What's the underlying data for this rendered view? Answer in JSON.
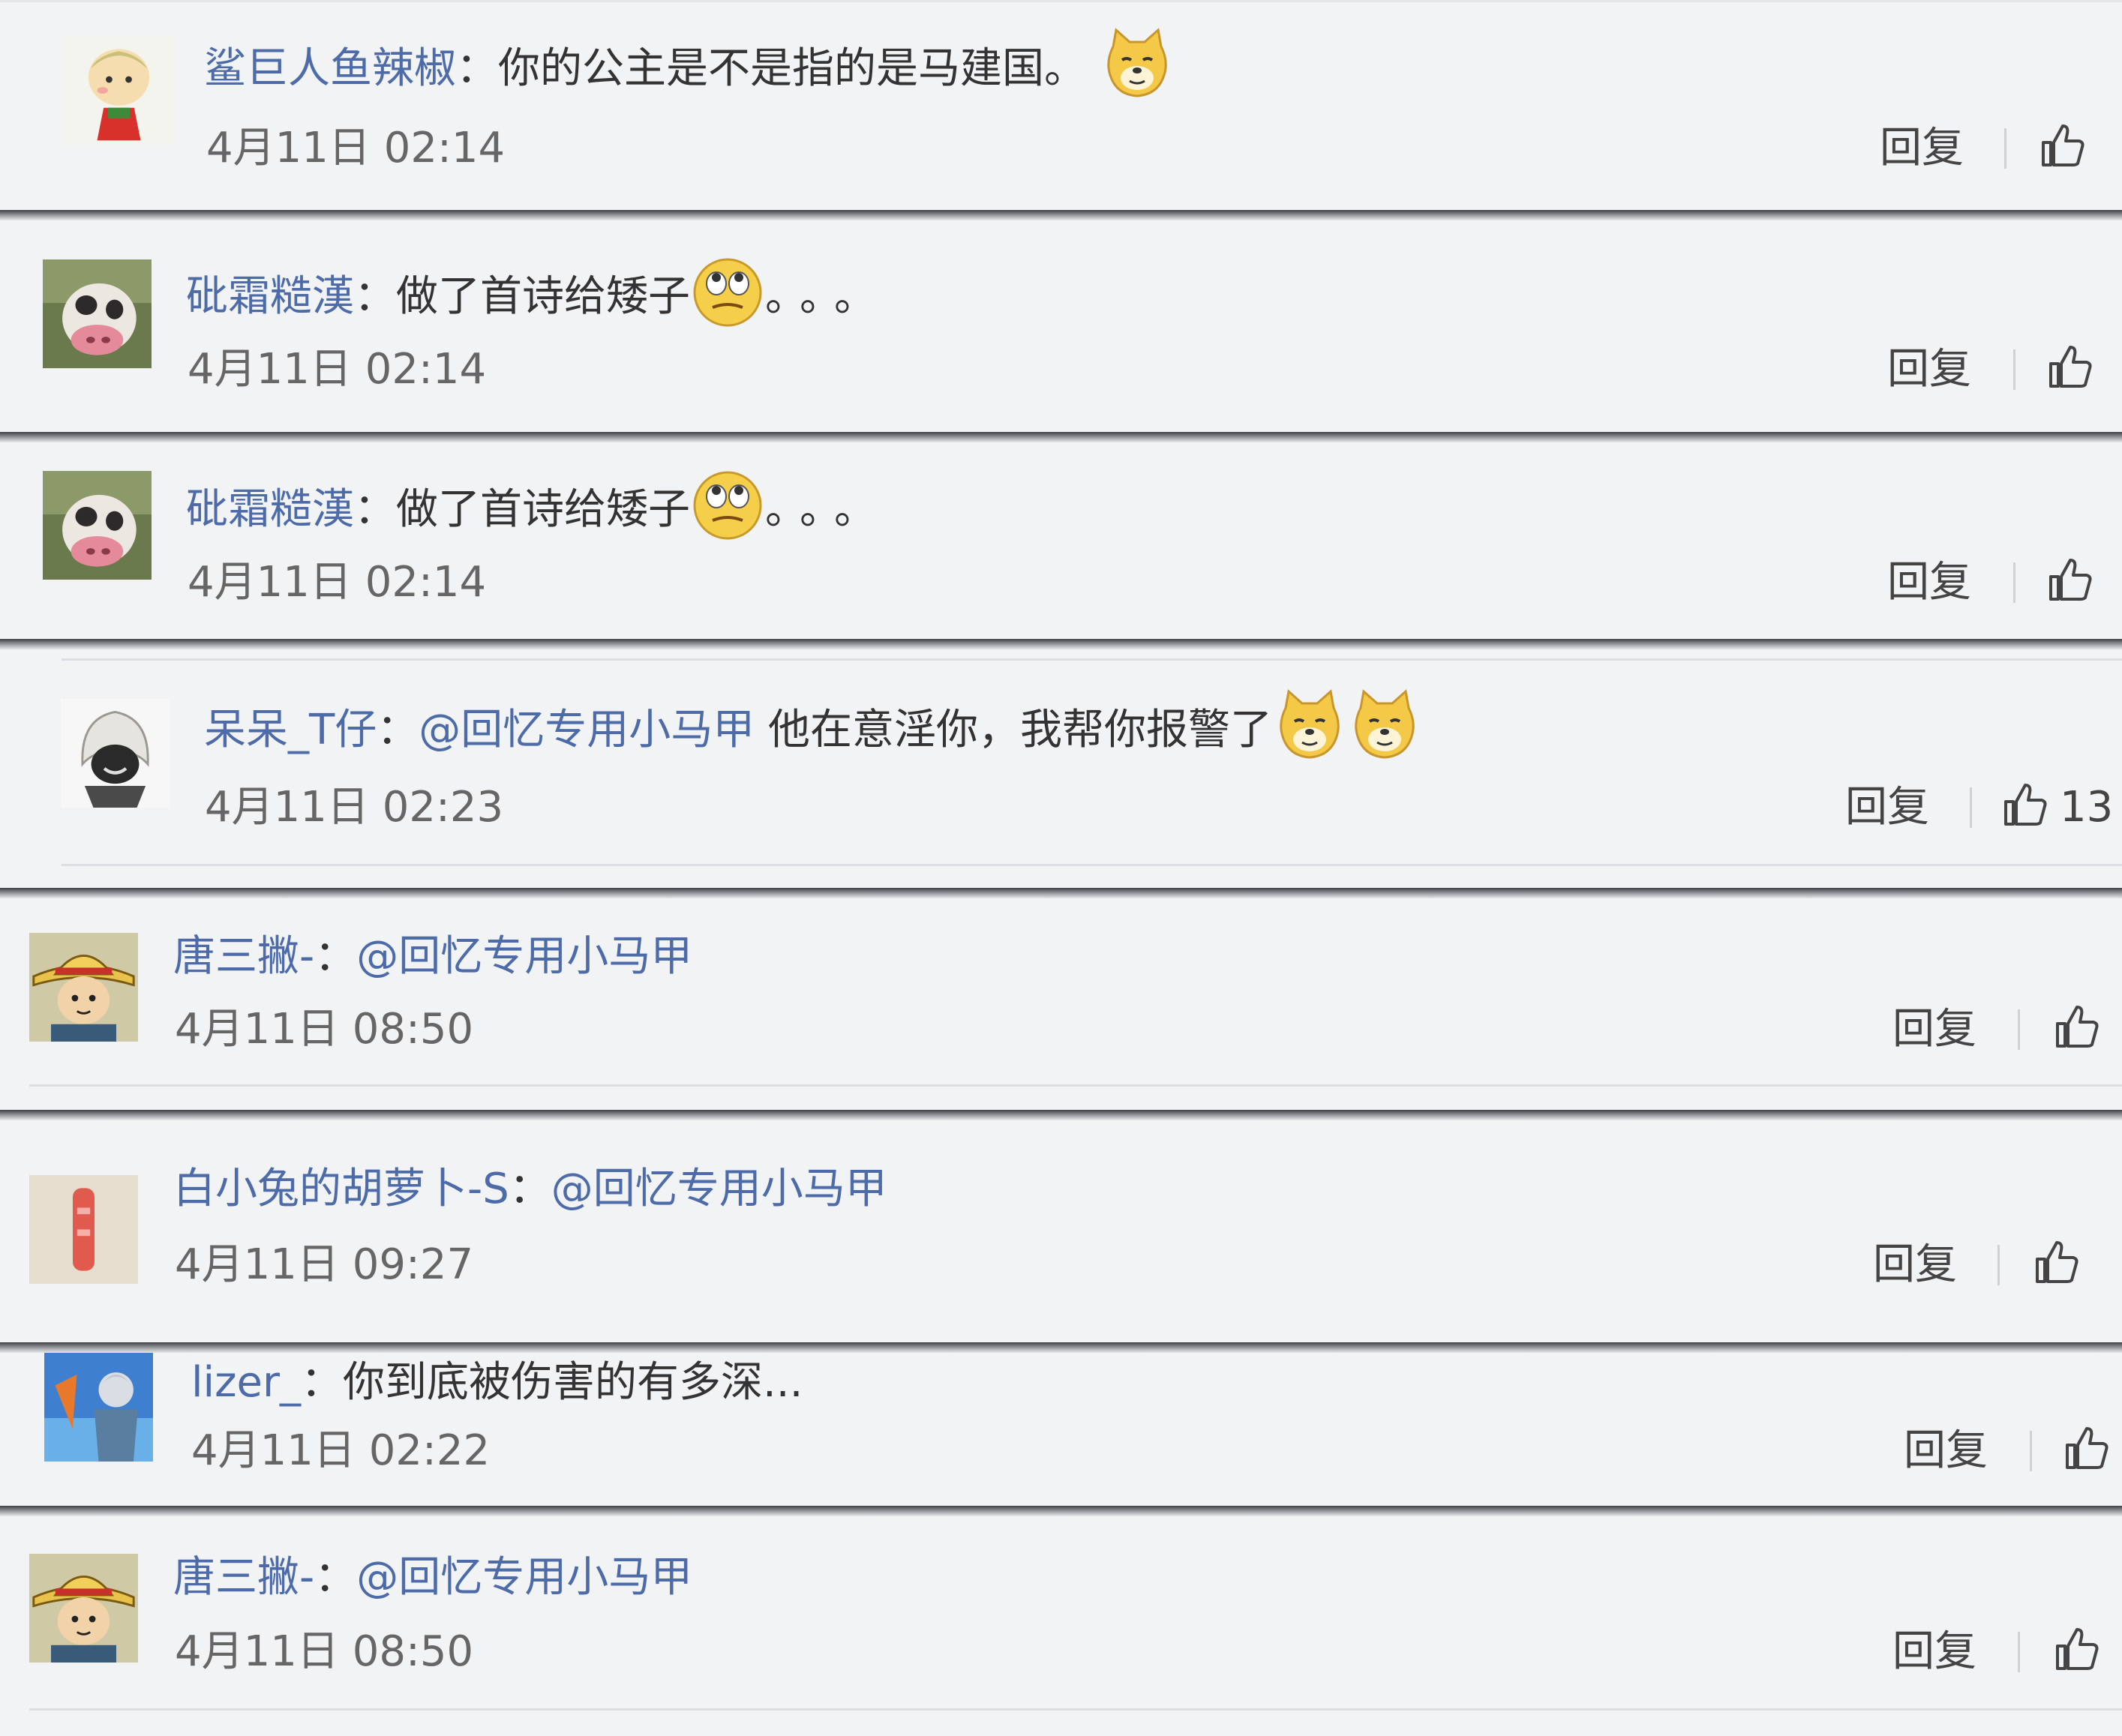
{
  "actions": {
    "reply_label": "回复"
  },
  "comments": [
    {
      "user": "鲨巨人鱼辣椒",
      "sep": "：",
      "mention": "",
      "text": "你的公主是不是指的是马建国。",
      "trail": "",
      "emoji": [
        "doge"
      ],
      "time": "4月11日 02:14",
      "likes": "",
      "avatar": "cartoon-boy-avatar"
    },
    {
      "user": "砒霜糙漢",
      "sep": "：",
      "mention": "",
      "text": "做了首诗给矮子",
      "trail": "。。。",
      "emoji": [
        "eye-roll"
      ],
      "time": "4月11日 02:14",
      "likes": "",
      "avatar": "cow-photo-avatar"
    },
    {
      "user": "砒霜糙漢",
      "sep": "：",
      "mention": "",
      "text": "做了首诗给矮子",
      "trail": "。。。",
      "emoji": [
        "eye-roll"
      ],
      "time": "4月11日 02:14",
      "likes": "",
      "avatar": "cow-photo-avatar"
    },
    {
      "user": "呆呆_T仔",
      "sep": "：",
      "mention": "@回忆专用小马甲",
      "text": " 他在意淫你，我帮你报警了",
      "trail": "",
      "emoji": [
        "doge",
        "doge"
      ],
      "time": "4月11日 02:23",
      "likes": "13",
      "avatar": "hooded-figure-avatar"
    },
    {
      "user": "唐三撇-",
      "sep": "：",
      "mention": "@回忆专用小马甲",
      "text": "",
      "trail": "",
      "emoji": [],
      "time": "4月11日 08:50",
      "likes": "",
      "avatar": "straw-hat-avatar"
    },
    {
      "user": "白小兔的胡萝卜-S",
      "sep": "：",
      "mention": "@回忆专用小马甲",
      "text": "",
      "trail": "",
      "emoji": [],
      "time": "4月11日 09:27",
      "likes": "",
      "avatar": "pink-object-avatar"
    },
    {
      "user": "lizer_",
      "sep": "：",
      "mention": "",
      "text": "你到底被伤害的有多深...",
      "trail": "",
      "emoji": [],
      "time": "4月11日 02:22",
      "likes": "",
      "avatar": "anime-character-avatar"
    },
    {
      "user": "唐三撇-",
      "sep": "：",
      "mention": "@回忆专用小马甲",
      "text": "",
      "trail": "",
      "emoji": [],
      "time": "4月11日 08:50",
      "likes": "",
      "avatar": "straw-hat-avatar"
    }
  ]
}
